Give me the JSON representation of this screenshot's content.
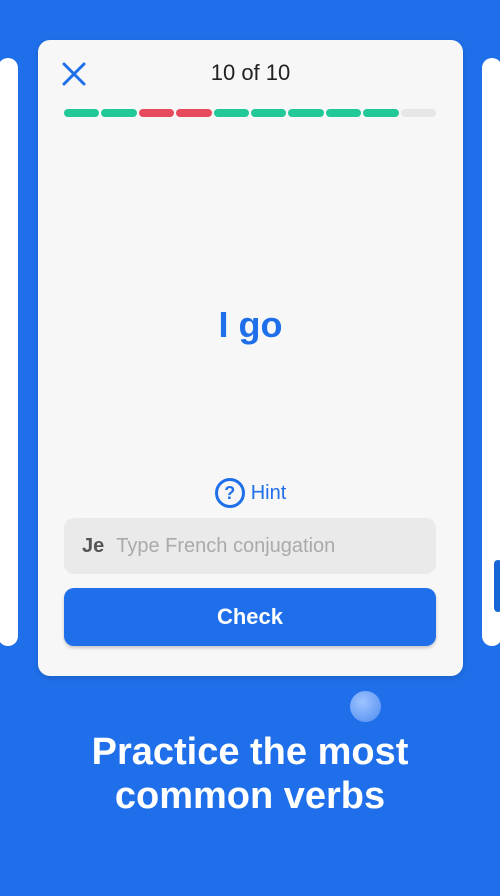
{
  "card": {
    "counter": "10 of 10",
    "prompt": "I go",
    "hint_label": "Hint",
    "hint_icon": "?",
    "pronoun": "Je",
    "answer_placeholder": "Type French conjugation",
    "check_label": "Check",
    "progress": [
      "good",
      "good",
      "bad",
      "bad",
      "good",
      "good",
      "good",
      "good",
      "good",
      "empty"
    ]
  },
  "tagline": [
    "Practice the most",
    "common verbs"
  ],
  "colors": {
    "background": "#1F6FEA",
    "accent": "#1F6FEA",
    "progress_good": "#20C997",
    "progress_bad": "#E64A5C"
  }
}
